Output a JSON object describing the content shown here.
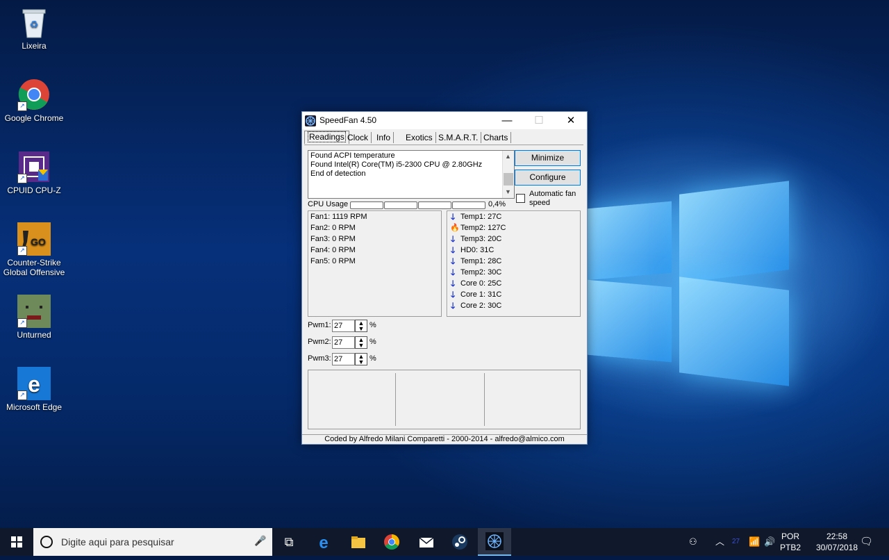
{
  "desktop": {
    "icons": [
      {
        "label": "Lixeira"
      },
      {
        "label": "Google Chrome"
      },
      {
        "label": "CPUID CPU-Z"
      },
      {
        "label": "Counter-Strike Global Offensive"
      },
      {
        "label": "Unturned"
      },
      {
        "label": "Microsoft Edge"
      }
    ]
  },
  "window": {
    "title": "SpeedFan 4.50",
    "minimize_glyph": "—",
    "maximize_glyph": "☐",
    "close_glyph": "✕",
    "tabs": [
      "Readings",
      "Clock",
      "Info",
      "Exotics",
      "S.M.A.R.T.",
      "Charts"
    ],
    "log_lines": [
      "Found ACPI temperature",
      "Found Intel(R) Core(TM) i5-2300 CPU @ 2.80GHz",
      "End of detection"
    ],
    "buttons": {
      "minimize": "Minimize",
      "configure": "Configure"
    },
    "auto_fan_label": "Automatic fan speed",
    "auto_fan_checked": false,
    "cpu_usage_label": "CPU Usage",
    "cpu_usage_value": "0,4%",
    "fans": [
      "Fan1: 1119 RPM",
      "Fan2: 0 RPM",
      "Fan3: 0 RPM",
      "Fan4: 0 RPM",
      "Fan5: 0 RPM"
    ],
    "temps": [
      {
        "text": "Temp1: 27C",
        "icon": "down-arrow-icon"
      },
      {
        "text": "Temp2: 127C",
        "icon": "fire-icon"
      },
      {
        "text": "Temp3: 20C",
        "icon": "down-arrow-icon"
      },
      {
        "text": "HD0:    31C",
        "icon": "down-arrow-icon"
      },
      {
        "text": "Temp1: 28C",
        "icon": "down-arrow-icon"
      },
      {
        "text": "Temp2: 30C",
        "icon": "down-arrow-icon"
      },
      {
        "text": "Core 0:  25C",
        "icon": "down-arrow-icon"
      },
      {
        "text": "Core 1:  31C",
        "icon": "down-arrow-icon"
      },
      {
        "text": "Core 2:  30C",
        "icon": "down-arrow-icon"
      }
    ],
    "pwm": [
      {
        "label": "Pwm1:",
        "value": "27",
        "unit": "%"
      },
      {
        "label": "Pwm2:",
        "value": "27",
        "unit": "%"
      },
      {
        "label": "Pwm3:",
        "value": "27",
        "unit": "%"
      }
    ],
    "status": "Coded by Alfredo Milani Comparetti - 2000-2014 - alfredo@almico.com"
  },
  "taskbar": {
    "search_placeholder": "Digite aqui para pesquisar",
    "lang_line1": "POR",
    "lang_line2": "PTB2",
    "time": "22:58",
    "date": "30/07/2018"
  },
  "colors": {
    "accent": "#0078d7",
    "taskbar": "#10192b",
    "arrow": "#1530c9",
    "fire": "#e24a00"
  }
}
